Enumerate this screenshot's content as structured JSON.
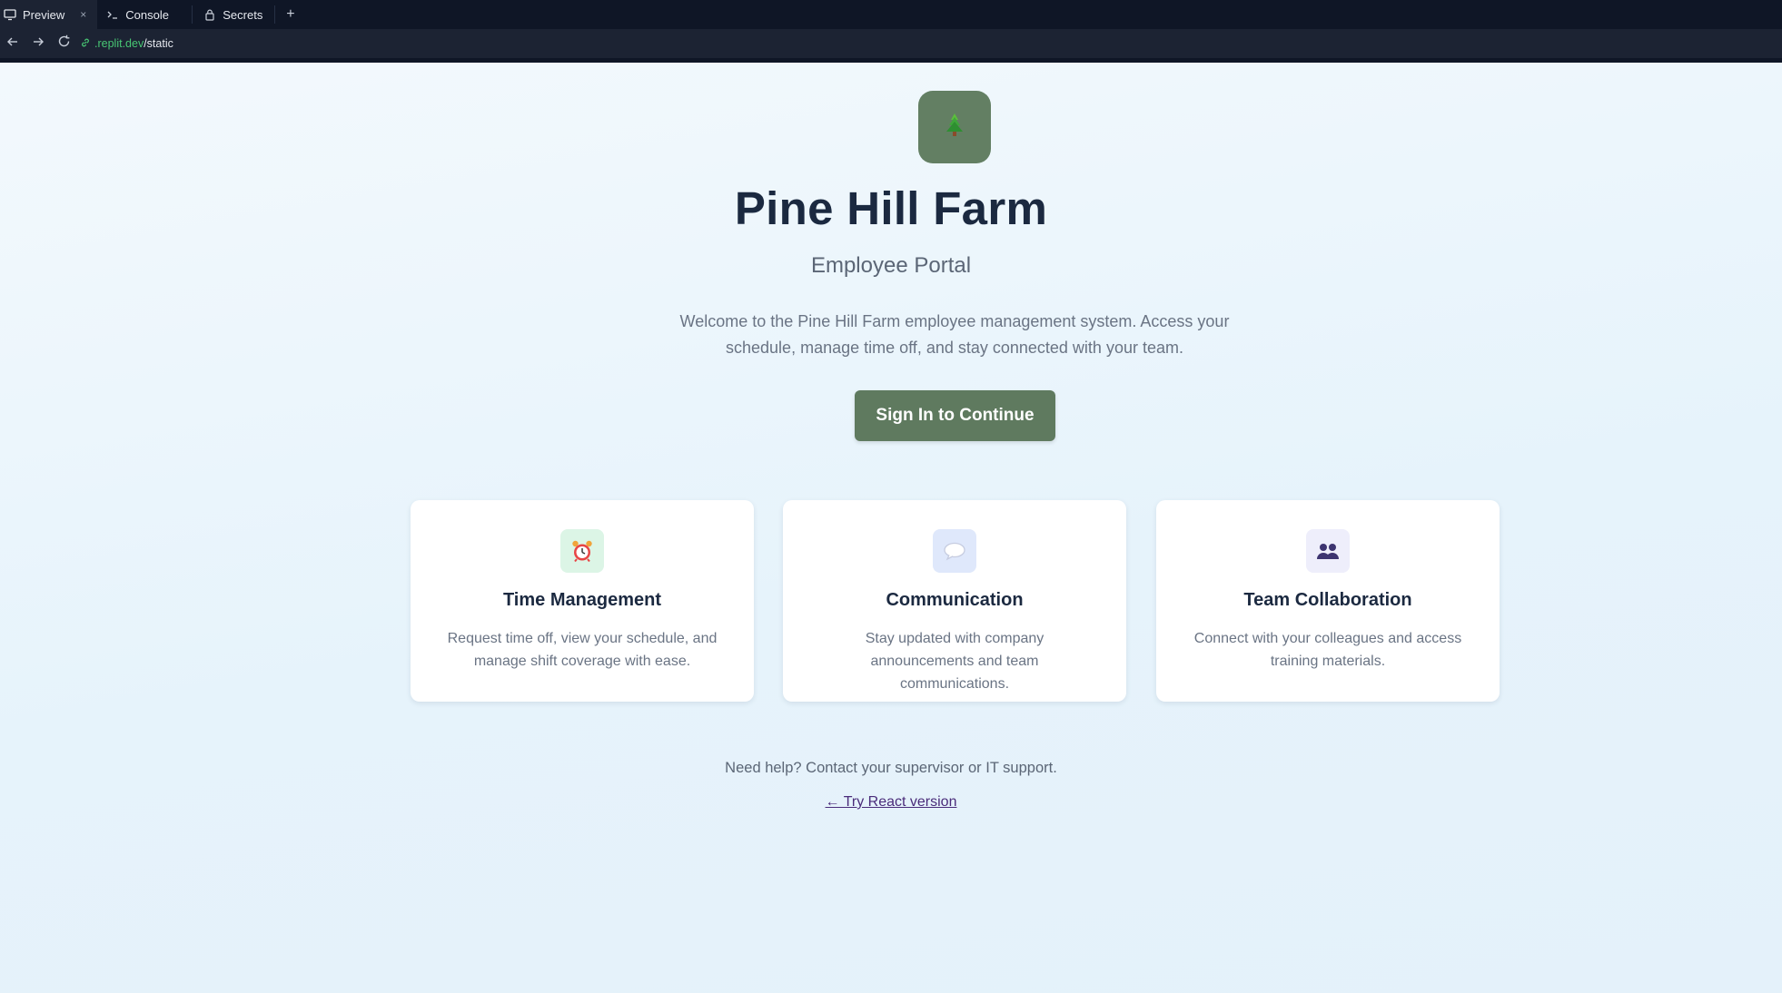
{
  "ide": {
    "tabs": [
      {
        "label": "Preview",
        "icon": "monitor-icon",
        "active": true
      },
      {
        "label": "Console",
        "icon": "terminal-icon",
        "active": false
      },
      {
        "label": "Secrets",
        "icon": "lock-icon",
        "active": false
      }
    ],
    "close_glyph": "×",
    "new_tab_glyph": "+",
    "url_domain": ".replit.dev",
    "url_path": "/static"
  },
  "hero": {
    "logo_icon": "pine-tree-icon",
    "title": "Pine Hill Farm",
    "subtitle": "Employee Portal",
    "intro": "Welcome to the Pine Hill Farm employee management system. Access your schedule, manage time off, and stay connected with your team.",
    "signin_label": "Sign In to Continue"
  },
  "features": [
    {
      "icon": "alarm-clock-icon",
      "title": "Time Management",
      "description": "Request time off, view your schedule, and manage shift coverage with ease."
    },
    {
      "icon": "speech-bubble-icon",
      "title": "Communication",
      "description": "Stay updated with company announcements and team communications."
    },
    {
      "icon": "people-icon",
      "title": "Team Collaboration",
      "description": "Connect with your colleagues and access training materials."
    }
  ],
  "footer": {
    "help_text": "Need help? Contact your supervisor or IT support.",
    "react_link": "← Try React version"
  },
  "colors": {
    "brand_green": "#5f7a5f",
    "title_navy": "#1b2940",
    "link_purple": "#4a2c7a"
  }
}
